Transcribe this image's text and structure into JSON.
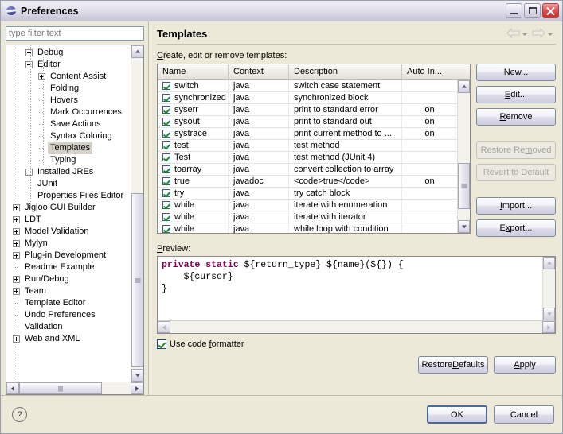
{
  "window": {
    "title": "Preferences",
    "icon": "eclipse-sphere-icon",
    "minimize_label": "",
    "maximize_label": "",
    "close_label": ""
  },
  "sidebar": {
    "filter_placeholder": "type filter text",
    "filter_value": "",
    "items": [
      {
        "label": "Debug",
        "indent": 1,
        "state": "collapsed",
        "selected": false
      },
      {
        "label": "Editor",
        "indent": 1,
        "state": "expanded",
        "selected": false
      },
      {
        "label": "Content Assist",
        "indent": 2,
        "state": "collapsed",
        "selected": false
      },
      {
        "label": "Folding",
        "indent": 2,
        "state": "leaf",
        "selected": false
      },
      {
        "label": "Hovers",
        "indent": 2,
        "state": "leaf",
        "selected": false
      },
      {
        "label": "Mark Occurrences",
        "indent": 2,
        "state": "leaf",
        "selected": false
      },
      {
        "label": "Save Actions",
        "indent": 2,
        "state": "leaf",
        "selected": false
      },
      {
        "label": "Syntax Coloring",
        "indent": 2,
        "state": "leaf",
        "selected": false
      },
      {
        "label": "Templates",
        "indent": 2,
        "state": "leaf",
        "selected": true
      },
      {
        "label": "Typing",
        "indent": 2,
        "state": "leaf",
        "selected": false
      },
      {
        "label": "Installed JREs",
        "indent": 1,
        "state": "collapsed",
        "selected": false
      },
      {
        "label": "JUnit",
        "indent": 1,
        "state": "leaf",
        "selected": false
      },
      {
        "label": "Properties Files Editor",
        "indent": 1,
        "state": "leaf",
        "selected": false
      },
      {
        "label": "Jigloo GUI Builder",
        "indent": 0,
        "state": "collapsed",
        "selected": false
      },
      {
        "label": "LDT",
        "indent": 0,
        "state": "collapsed",
        "selected": false
      },
      {
        "label": "Model Validation",
        "indent": 0,
        "state": "collapsed",
        "selected": false
      },
      {
        "label": "Mylyn",
        "indent": 0,
        "state": "collapsed",
        "selected": false
      },
      {
        "label": "Plug-in Development",
        "indent": 0,
        "state": "collapsed",
        "selected": false
      },
      {
        "label": "Readme Example",
        "indent": 0,
        "state": "leaf",
        "selected": false
      },
      {
        "label": "Run/Debug",
        "indent": 0,
        "state": "collapsed",
        "selected": false
      },
      {
        "label": "Team",
        "indent": 0,
        "state": "collapsed",
        "selected": false
      },
      {
        "label": "Template Editor",
        "indent": 0,
        "state": "leaf",
        "selected": false
      },
      {
        "label": "Undo Preferences",
        "indent": 0,
        "state": "leaf",
        "selected": false
      },
      {
        "label": "Validation",
        "indent": 0,
        "state": "leaf",
        "selected": false
      },
      {
        "label": "Web and XML",
        "indent": 0,
        "state": "collapsed",
        "selected": false
      }
    ]
  },
  "page": {
    "title": "Templates",
    "description": "Create, edit or remove templates:",
    "nav_back": "back-arrow",
    "nav_forward": "forward-arrow"
  },
  "table": {
    "columns": [
      "Name",
      "Context",
      "Description",
      "Auto In..."
    ],
    "rows": [
      {
        "checked": true,
        "name": "switch",
        "context": "java",
        "description": "switch case statement",
        "auto_insert": ""
      },
      {
        "checked": true,
        "name": "synchronized",
        "context": "java",
        "description": "synchronized block",
        "auto_insert": ""
      },
      {
        "checked": true,
        "name": "syserr",
        "context": "java",
        "description": "print to standard error",
        "auto_insert": "on"
      },
      {
        "checked": true,
        "name": "sysout",
        "context": "java",
        "description": "print to standard out",
        "auto_insert": "on"
      },
      {
        "checked": true,
        "name": "systrace",
        "context": "java",
        "description": "print current method to ...",
        "auto_insert": "on"
      },
      {
        "checked": true,
        "name": "test",
        "context": "java",
        "description": "test method",
        "auto_insert": ""
      },
      {
        "checked": true,
        "name": "Test",
        "context": "java",
        "description": "test method (JUnit 4)",
        "auto_insert": ""
      },
      {
        "checked": true,
        "name": "toarray",
        "context": "java",
        "description": "convert collection to array",
        "auto_insert": ""
      },
      {
        "checked": true,
        "name": "true",
        "context": "javadoc",
        "description": "<code>true</code>",
        "auto_insert": "on"
      },
      {
        "checked": true,
        "name": "try",
        "context": "java",
        "description": "try catch block",
        "auto_insert": ""
      },
      {
        "checked": true,
        "name": "while",
        "context": "java",
        "description": "iterate with enumeration",
        "auto_insert": ""
      },
      {
        "checked": true,
        "name": "while",
        "context": "java",
        "description": "iterate with iterator",
        "auto_insert": ""
      },
      {
        "checked": true,
        "name": "while",
        "context": "java",
        "description": "while loop with condition",
        "auto_insert": ""
      }
    ]
  },
  "side_buttons": [
    {
      "label": "New...",
      "enabled": true
    },
    {
      "label": "Edit...",
      "enabled": true
    },
    {
      "label": "Remove",
      "enabled": true
    },
    {
      "label": "Restore Removed",
      "enabled": false
    },
    {
      "label": "Revert to Default",
      "enabled": false
    },
    {
      "label": "Import...",
      "enabled": true
    },
    {
      "label": "Export...",
      "enabled": true
    }
  ],
  "preview": {
    "label": "Preview:",
    "keyword1": "private",
    "keyword2": "static",
    "line1_rest": " ${return_type} ${name}(${}) {",
    "line2": "    ${cursor}",
    "line3": "}"
  },
  "formatter": {
    "label": "Use code formatter",
    "checked": true
  },
  "page_buttons": {
    "restore_defaults": "Restore Defaults",
    "apply": "Apply"
  },
  "footer": {
    "help_icon": "?",
    "ok": "OK",
    "cancel": "Cancel"
  },
  "colors": {
    "keyword": "#7f0055",
    "selection": "#d5d1c9",
    "check_green": "#1f8b28",
    "close_red": "#c23030"
  }
}
